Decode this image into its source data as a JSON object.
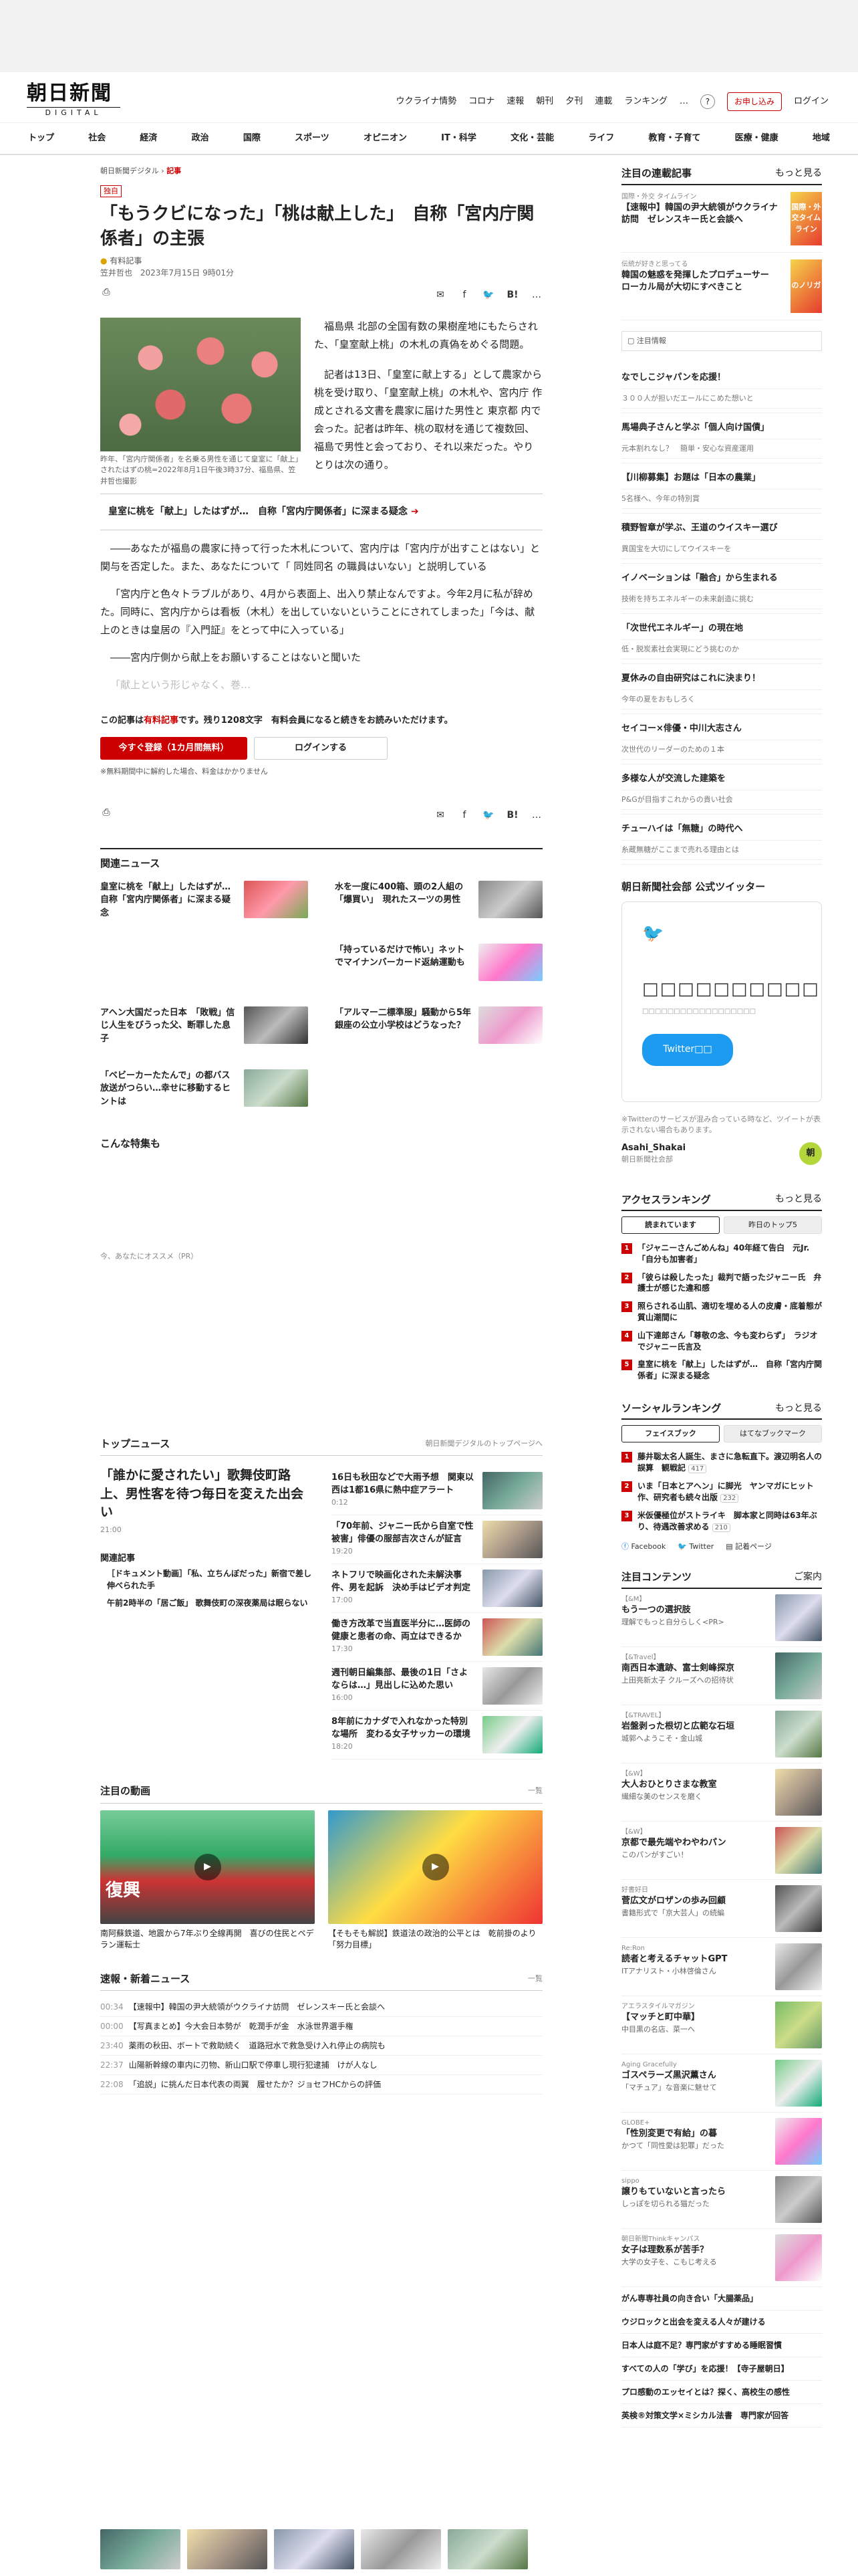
{
  "header": {
    "logo_jp": "朝日新聞",
    "logo_en": "DIGITAL",
    "links": [
      "ウクライナ情勢",
      "コロナ",
      "速報",
      "朝刊",
      "夕刊",
      "連載",
      "ランキング"
    ],
    "more": "…",
    "help": "?",
    "subscribe": "お申し込み",
    "login": "ログイン"
  },
  "nav": [
    "トップ",
    "社会",
    "経済",
    "政治",
    "国際",
    "スポーツ",
    "オピニオン",
    "IT・科学",
    "文化・芸能",
    "ライフ",
    "教育・子育て",
    "医療・健康",
    "地域"
  ],
  "article": {
    "breadcrumb": [
      "朝日新聞デジタル",
      "記事"
    ],
    "badge": "独自",
    "title": "「もうクビになった」「桃は献上した」　自称「宮内庁関係者」の主張",
    "premium": "有料記事",
    "author": "笠井哲也",
    "date": "2023年7月15日 9時01分",
    "list_label": "list",
    "photo_caption": "昨年、「宮内庁関係者」を名乗る男性を通じて皇室に「献上」されたはずの桃=2022年8月1日午後3時37分、福島県、笠井哲也撮影",
    "paragraphs": [
      "福島県 北部の全国有数の果樹産地にもたらされた、「皇室献上桃」の木札の真偽をめぐる問題。",
      "記者は13日、「皇室に献上する」として農家から桃を受け取り、「皇室献上桃」の木札や、宮内庁 作成とされる文書を農家に届けた男性と 東京都 内で会った。記者は昨年、桃の取材を通じて複数回、福島で男性と会っており、それ以来だった。やりとりは次の通り。"
    ],
    "link_box": "皇室に桃を「献上」したはずが…　自称「宮内庁関係者」に深まる疑念",
    "fade": [
      "――あなたが福島の農家に持って行った木札について、宮内庁は「宮内庁が出すことはない」と関与を否定した。また、あなたについて「 同姓同名 の職員はいない」と説明している",
      "「宮内庁と色々トラブルがあり、4月から表面上、出入り禁止なんですよ。今年2月に私が辞めた。同時に、宮内庁からは看板（木札）を出していないということにされてしまった」「今は、献上のときは皇居の『入門証』をとって中に入っている」",
      "――宮内庁側から献上をお願いすることはないと聞いた",
      "「献上という形じゃなく、巻…"
    ],
    "paywall_a": "この記事は",
    "paywall_b": "有料記事",
    "paywall_c": "です。残り1208文字　有料会員になると続きをお読みいただけます。",
    "btn_register": "今すぐ登録（1カ月間無料）",
    "btn_login": "ログインする",
    "note": "※無料期間中に解約した場合、料金はかかりません"
  },
  "related": {
    "heading": "関連ニュース",
    "items": [
      "皇室に桃を「献上」したはずが…　自称「宮内庁関係者」に深まる疑念",
      "水を一度に400箱、頭の2人組の「爆買い」　現れたスーツの男性",
      "「持っているだけで怖い」ネットでマイナンバーカード返納運動も",
      "アヘン大国だった日本　「敗戦」信じ人生をびうった父、断罪した息子",
      "「アルマー二標準服」騒動から5年　銀座の公立小学校はどうなった？",
      "「ベビーカーたたんで」の都バス放送がつらい…幸せに移動するヒントは"
    ]
  },
  "featured_heading": "こんな特集も",
  "pr_label": "今、あなたにオススメ（PR）",
  "top_news": {
    "heading": "トップニュース",
    "more": "朝日新聞デジタルのトップページへ",
    "lead": "「誰かに愛されたい」歌舞伎町路上、男性客を待つ毎日を変えた出会い",
    "lead_time": "21:00",
    "items": [
      {
        "t": "16日も秋田などで大雨予想　関東以西は1都16県に熱中症アラート",
        "time": "0:12"
      },
      {
        "t": "「70年前、ジャニー氏から自室で性被害」俳優の服部吉次さんが証言",
        "time": "19:20"
      },
      {
        "t": "ネトフリで映画化された未解決事件、男を起訴　決め手はビデオ判定",
        "time": "17:00"
      },
      {
        "t": "働き方改革で当直医半分に…医師の健康と患者の命、両立はできるか",
        "time": "17:30"
      },
      {
        "t": "週刊朝日編集部、最後の1日「さよならは…」見出しに込めた思い",
        "time": "16:00"
      },
      {
        "t": "8年前にカナダで入れなかった特別な場所　変わる女子サッカーの環境",
        "time": "18:20"
      }
    ],
    "related_heading": "関連記事",
    "related": [
      "［ドキュメント動画］「私、立ちんぼだった」新宿で差し伸べられた手",
      "午前2時半の「居ご飯」 歌舞伎町の深夜薬局は眠らない"
    ]
  },
  "videos": {
    "heading": "注目の動画",
    "more": "一覧",
    "items": [
      {
        "cap": "南阿蘇鉄道、地震から7年ぶり全線再開　喜びの住民とペデラン運転士",
        "overlay": "復興"
      },
      {
        "cap": "【そもそも解説】鉄道法の政治的公平とは　乾前掛のより「努力目標」",
        "overlay": ""
      }
    ]
  },
  "breaking": {
    "heading": "速報・新着ニュース",
    "more": "一覧",
    "items": [
      {
        "tm": "00:34",
        "t": "【速報中】韓国の尹大統領がウクライナ訪問　ゼレンスキー氏と会談へ"
      },
      {
        "tm": "00:00",
        "t": "【写真まとめ】今大会日本勢が　乾潤手が金　水泳世界選手権"
      },
      {
        "tm": "23:40",
        "t": "薬雨の秋田、ボートで救助続く　道路冠水で救急受け入れ停止の病院も"
      },
      {
        "tm": "22:37",
        "t": "山陽新幹線の車内に刃物、新山口駅で停車し現行犯逮捕　けが人なし"
      },
      {
        "tm": "22:08",
        "t": "「追説」に挑んだ日本代表の両翼　履せたか？ジョセフHCからの評価"
      }
    ]
  },
  "sidebar": {
    "serial_heading": "注目の連載記事",
    "more": "もっと見る",
    "serial": [
      {
        "lab": "国際・外交 タイムライン",
        "t": "【速報中】韓国の尹大統領がウクライナ訪問　ゼレンスキー氏と会談へ",
        "banner": "国際・外交タイムライン"
      },
      {
        "lab": "伝統が好きと思ってる",
        "t": "韓国の魅惑を発揮したプロデューサー　ローカル局が大切にすべきこと",
        "banner": "のノリガ"
      }
    ],
    "notice_label": "注目情報",
    "pr": [
      {
        "t": "なでしこジャパンを応援！",
        "s": "３００人が担いだエールにこめた想いと"
      },
      {
        "t": "馬場典子さんと学ぶ「個人向け国債」",
        "s": "元本割れなし？　簡単・安心な資産運用"
      },
      {
        "t": "【川柳募集】お題は「日本の農業」",
        "s": "5名様へ、今年の特別賞"
      },
      {
        "t": "積野智章が学ぶ、王道のウイスキー選び",
        "s": "異国宝を大切にしてウイスキーを"
      },
      {
        "t": "イノベーションは「融合」から生まれる",
        "s": "技術を持ちエネルギーの未来創造に挑む"
      },
      {
        "t": "「次世代エネルギー」の現在地",
        "s": "低・脱炭素社会実現にどう挑むのか"
      },
      {
        "t": "夏休みの自由研究はこれに決まり！",
        "s": "今年の夏をおもしろく"
      },
      {
        "t": "セイコー×俳優・中川大志さん",
        "s": "次世代のリーダーのための１本"
      },
      {
        "t": "多様な人が交流した建築を",
        "s": "P&Gが目指すこれからの貴い社会"
      },
      {
        "t": "チューハイは「無糖」の時代へ",
        "s": "糸蔵無糖がここまで売れる理由とは"
      }
    ],
    "twitter_heading": "朝日新聞社会部 公式ツイッター",
    "twitter_mock": "□□□□□□□□□□",
    "twitter_sub": "□□□□□□□□□□□□□□□□□□",
    "twitter_btn": "Twitter□□",
    "twitter_note": "※Twitterのサービスが混み合っている時など、ツイートが表示されない場合もあります。",
    "account": "Asahi_Shakai",
    "account_sub": "朝日新聞社会部",
    "avatar": "朝",
    "ranking_heading": "アクセスランキング",
    "ranking_tabs": [
      "読まれています",
      "昨日のトップ5"
    ],
    "ranking": [
      "「ジャニーさんごめんね」40年経て告白　元Jr.「自分も加害者」",
      "「彼らは殺したった」裁判で語ったジャニー氏　弁護士が感じた違和感",
      "照らされる山肌、適切を埋める人の皮膚・底着態が質山潮間に",
      "山下達郎さん「尊敬の念、今も変わらず」　ラジオでジャニー氏言及",
      "皇室に桃を「献上」したはずが…　自称「宮内庁関係者」に深まる疑念"
    ],
    "social_heading": "ソーシャルランキング",
    "social_tabs": [
      "フェイスブック",
      "はてなブックマーク"
    ],
    "social": [
      {
        "t": "藤井聡太名人誕生、まさに急転直下。渡辺明名人の誤算　観戦記",
        "c": "417"
      },
      {
        "t": "いま「日本とアヘン」に脚光　ヤンマガにヒット作、研究者も続々出版",
        "c": "232"
      },
      {
        "t": "米仮優極位がストライキ　脚本家と同時は63年ぶり、待遇改善求める",
        "c": "210"
      }
    ],
    "social_links": [
      "Facebook",
      "Twitter",
      "記着ページ"
    ],
    "content_heading": "注目コンテンツ",
    "content_more": "ご案内",
    "content": [
      {
        "lab": "【&M】",
        "t": "もう一つの選択肢",
        "s": "理解でもっと自分らしく<PR>"
      },
      {
        "lab": "【&Travel】",
        "t": "南西日本遺跡、富士剣峰探京",
        "s": "上田亮新太子 クルーズへの招待状"
      },
      {
        "lab": "【&TRAVEL】",
        "t": "岩盤剥った根切と広範な石垣",
        "s": "城郭へようこそ・金山城"
      },
      {
        "lab": "【&W】",
        "t": "大人おひとりさまな教室",
        "s": "繊細な美のセンスを磨く"
      },
      {
        "lab": "【&W】",
        "t": "京都で最先端やわやわパン",
        "s": "このパンがすごい！"
      },
      {
        "lab": "好書好日",
        "t": "菅広文がロザンの歩み回顧",
        "s": "書籍形式で「京大芸人」の続編"
      },
      {
        "lab": "Re:Ron",
        "t": "読者と考えるチャットGPT",
        "s": "ITアナリスト・小林啓倫さん"
      },
      {
        "lab": "アエラスタイルマガジン",
        "t": "【マッチと町中華】",
        "s": "中目黒の名店、菜一へ"
      },
      {
        "lab": "Aging Gracefully",
        "t": "ゴスペラーズ黒沢薫さん",
        "s": "「マチュア」な音楽に魅せて"
      },
      {
        "lab": "GLOBE+",
        "t": "「性別変更で有給」の暮",
        "s": "かつて「同性愛は犯罪」だった"
      },
      {
        "lab": "sippo",
        "t": "譲りもていないと言ったら",
        "s": "しっぽを切られる猫だった"
      },
      {
        "lab": "朝日新聞Thinkキャンパス",
        "t": "女子は理数系が苦手？",
        "s": "大学の女子を、こもじ考える"
      }
    ],
    "content_plain": [
      "がん専専社員の向き合い「大腸薬品」",
      "ウジロックと出会を変える人々が建ける",
      "日本人は庭不足？専門家がすすめる睡眠習慣",
      "すべての人の「学び」を応援！【寺子屋朝日】",
      "プロ感動のエッセイとは？探く、高校生の感性",
      "英検®対策文学×ミシカル法書　専門家が回答"
    ]
  }
}
